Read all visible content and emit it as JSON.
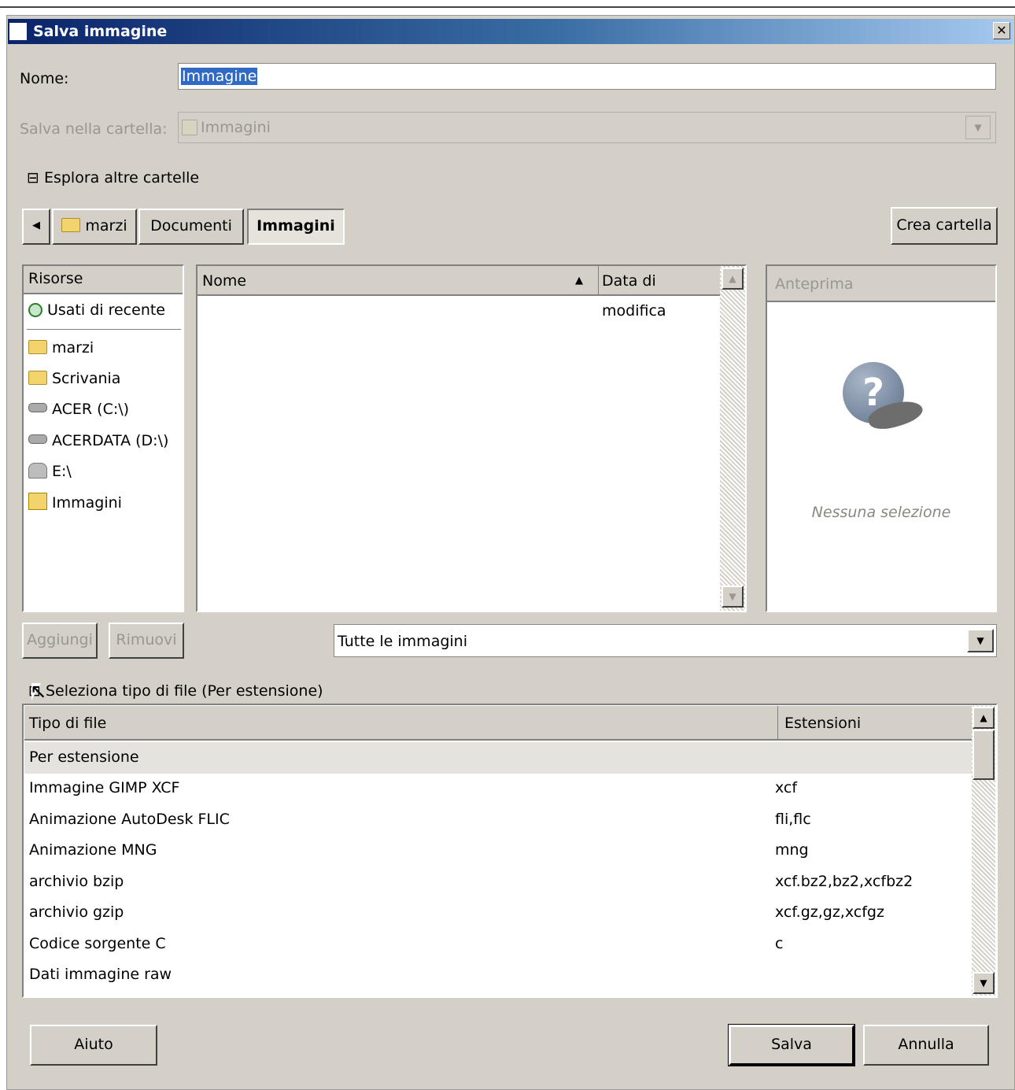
{
  "dialog": {
    "title": "Salva immagine",
    "close_glyph": "✕"
  },
  "name_row": {
    "label": "Nome:",
    "value": "Immagine"
  },
  "folder_row": {
    "label": "Salva nella cartella:",
    "value": "Immagini"
  },
  "browse": {
    "toggle_glyph": "⊟",
    "label": "Esplora altre cartelle"
  },
  "breadcrumb": {
    "back_glyph": "◀",
    "items": [
      "marzi",
      "Documenti",
      "Immagini"
    ]
  },
  "create_folder_label": "Crea cartella",
  "places": {
    "header": "Risorse",
    "recent": "Usati di recente",
    "items": [
      "marzi",
      "Scrivania",
      "ACER (C:\\)",
      "ACERDATA (D:\\)",
      "E:\\",
      "Immagini"
    ],
    "add_label": "Aggiungi",
    "remove_label": "Rimuovi"
  },
  "files": {
    "col_name": "Nome",
    "col_date": "Data di modifica",
    "sort_glyph": "▲"
  },
  "preview": {
    "header": "Anteprima",
    "placeholder_glyph": "?",
    "empty": "Nessuna selezione"
  },
  "filter": {
    "value": "Tutte le immagini",
    "arrow_glyph": "▼"
  },
  "filetype": {
    "toggle_glyph": "⊞",
    "label": "Seleziona tipo di file (Per estensione)",
    "col_type": "Tipo di file",
    "col_ext": "Estensioni",
    "rows": [
      {
        "name": "Per estensione",
        "ext": ""
      },
      {
        "name": "Immagine GIMP XCF",
        "ext": "xcf"
      },
      {
        "name": "Animazione AutoDesk FLIC",
        "ext": "fli,flc"
      },
      {
        "name": "Animazione MNG",
        "ext": "mng"
      },
      {
        "name": "archivio bzip",
        "ext": "xcf.bz2,bz2,xcfbz2"
      },
      {
        "name": "archivio gzip",
        "ext": "xcf.gz,gz,xcfgz"
      },
      {
        "name": "Codice sorgente C",
        "ext": "c"
      },
      {
        "name": "Dati immagine raw",
        "ext": ""
      }
    ]
  },
  "footer": {
    "help_label": "Aiuto",
    "save_label": "Salva",
    "cancel_label": "Annulla"
  },
  "scroll": {
    "up_glyph": "▲",
    "down_glyph": "▼"
  },
  "colors": {
    "dialog_bg": "#d4d0c8",
    "titlebar_start": "#0a246a",
    "titlebar_end": "#a6caf0",
    "selection": "#316ac5"
  }
}
